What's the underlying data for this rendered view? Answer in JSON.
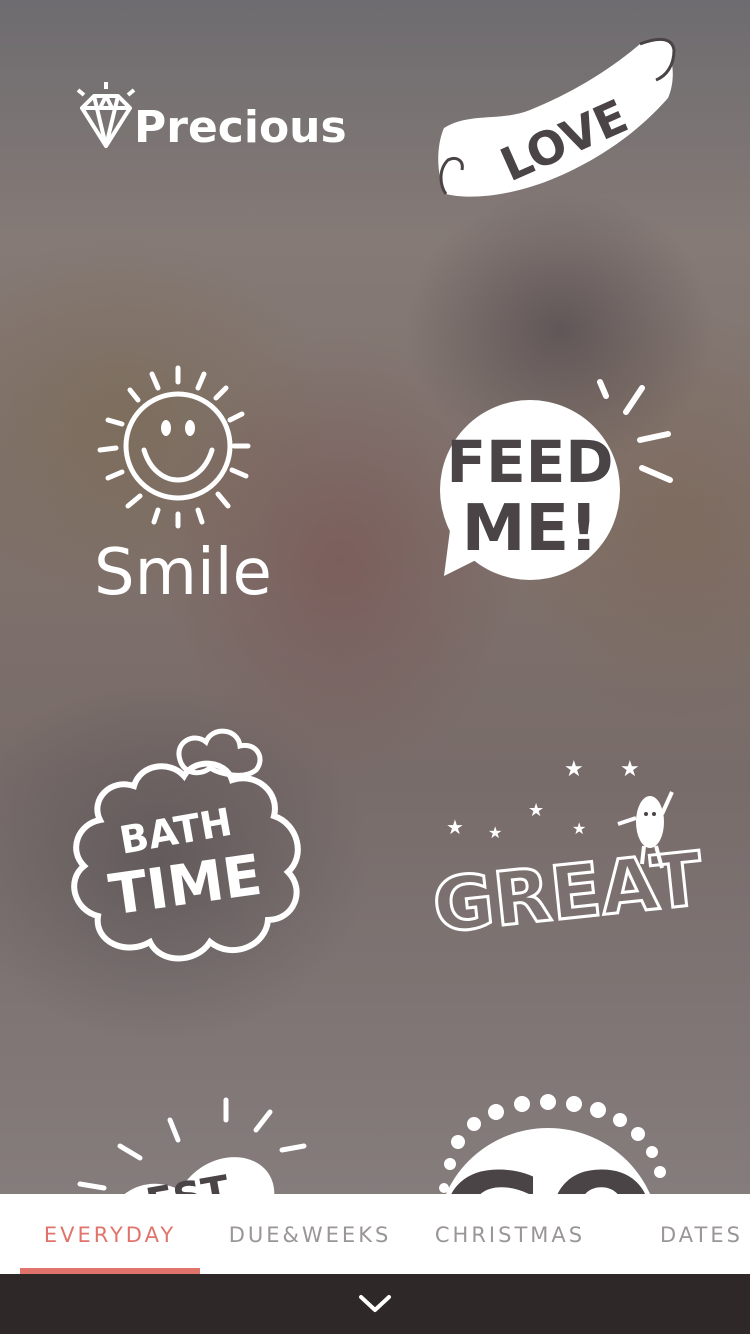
{
  "stickers": {
    "precious": {
      "label": "Precious"
    },
    "love": {
      "label": "LOVE"
    },
    "smile": {
      "label": "Smile"
    },
    "feed_me": {
      "line1": "FEED",
      "line2": "ME!"
    },
    "bath_time": {
      "line1": "BATH",
      "line2": "TIME"
    },
    "great": {
      "label": "GREAT"
    },
    "best": {
      "label": "EST"
    },
    "go": {
      "label": "GO"
    }
  },
  "tabs": [
    {
      "label": "EVERYDAY",
      "active": true
    },
    {
      "label": "DUE&WEEKS",
      "active": false
    },
    {
      "label": "CHRISTMAS",
      "active": false
    },
    {
      "label": "DATES",
      "active": false
    }
  ],
  "colors": {
    "accent": "#e0746c",
    "tab_inactive": "#9a9597",
    "bottom_bar": "#2e2828"
  },
  "icons": {
    "collapse": "chevron-down-icon",
    "diamond": "diamond-icon"
  }
}
